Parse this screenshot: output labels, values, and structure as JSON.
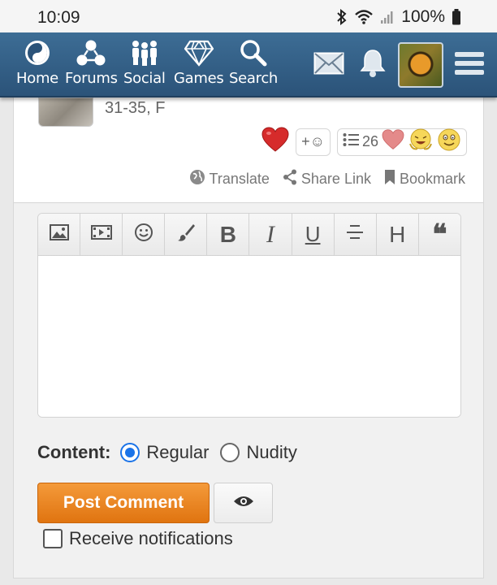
{
  "status": {
    "time": "10:09",
    "battery": "100%"
  },
  "nav": {
    "items": [
      {
        "label": "Home",
        "icon": "yin-yang-icon"
      },
      {
        "label": "Forums",
        "icon": "forums-icon"
      },
      {
        "label": "Social",
        "icon": "people-icon"
      },
      {
        "label": "Games",
        "icon": "diamond-icon"
      },
      {
        "label": "Search",
        "icon": "search-icon"
      }
    ]
  },
  "post": {
    "user_info": "31-35, F",
    "reaction_count": "26",
    "add_reaction": "+☺"
  },
  "actions": {
    "translate": "Translate",
    "share": "Share Link",
    "bookmark": "Bookmark"
  },
  "editor": {
    "tools": [
      "image-icon",
      "video-icon",
      "emoji-icon",
      "brush-icon",
      "bold-icon",
      "italic-icon",
      "underline-icon",
      "strikethrough-icon",
      "heading-icon",
      "quote-icon"
    ],
    "bold": "B",
    "italic": "I",
    "underline": "U",
    "heading": "H",
    "quote": "❝"
  },
  "content": {
    "label": "Content:",
    "options": [
      {
        "label": "Regular",
        "selected": true
      },
      {
        "label": "Nudity",
        "selected": false
      }
    ]
  },
  "buttons": {
    "post": "Post Comment"
  },
  "notify": {
    "label": "Receive notifications",
    "checked": false
  },
  "colors": {
    "nav": "#2b5379",
    "accent": "#e07410",
    "radio": "#1a73e8"
  }
}
